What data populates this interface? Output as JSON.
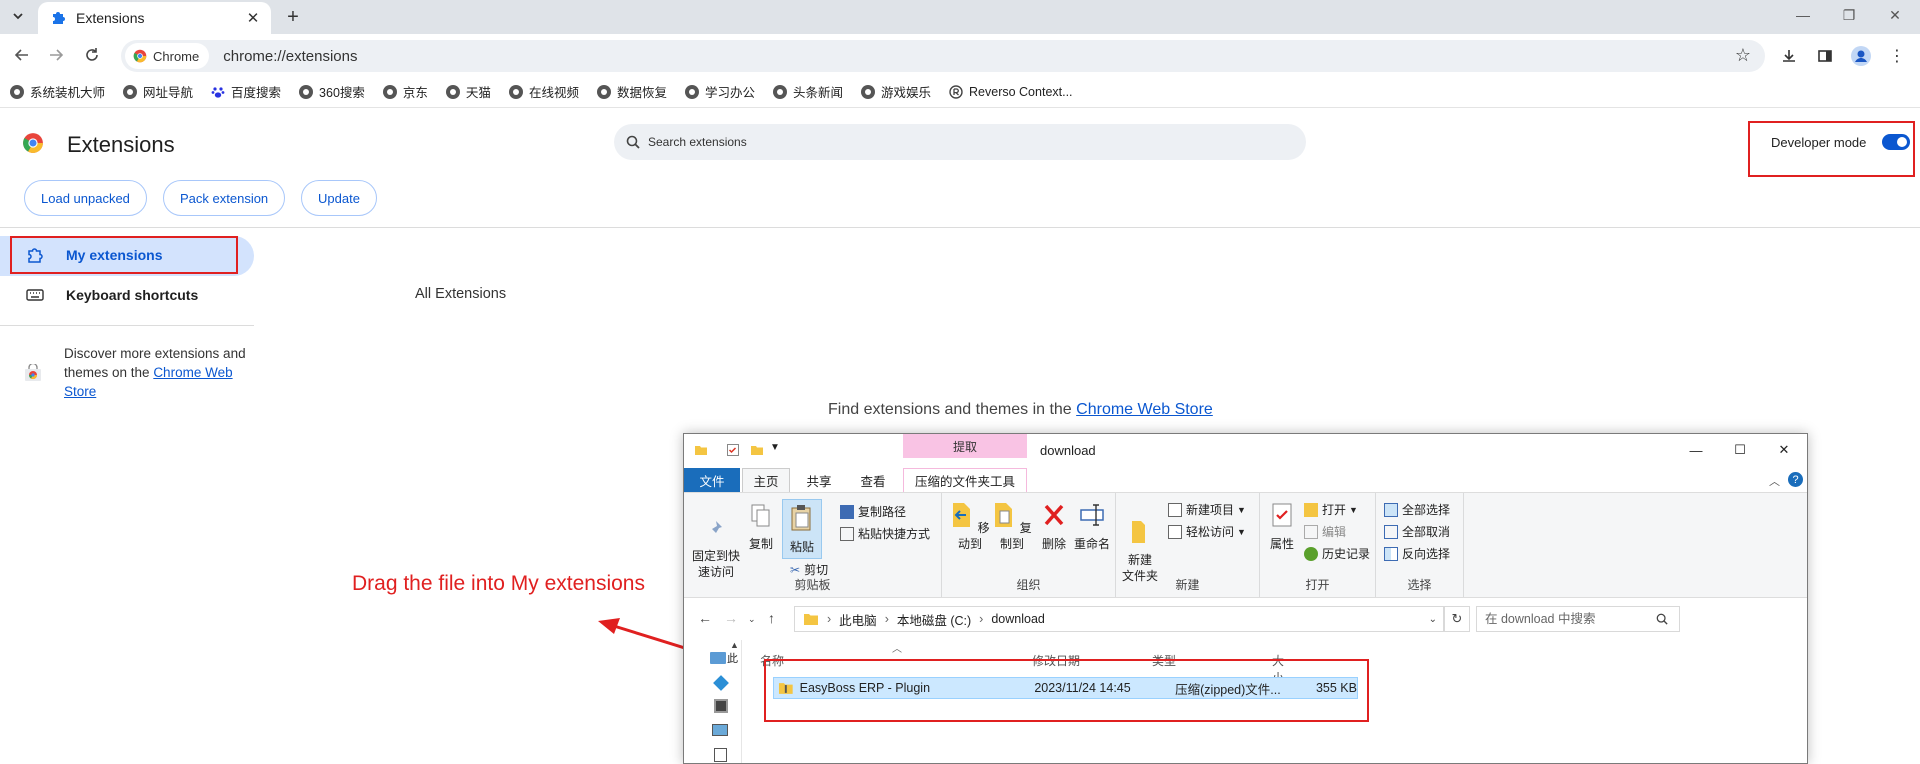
{
  "tab": {
    "title": "Extensions",
    "close": "✕",
    "new": "+"
  },
  "window_controls": {
    "minimize": "—",
    "restore": "❐",
    "close": "✕"
  },
  "omnibox": {
    "site_chip": "Chrome",
    "url": "chrome://extensions"
  },
  "bookmarks": [
    {
      "label": "系统装机大师",
      "icon": "globe-icon"
    },
    {
      "label": "网址导航",
      "icon": "globe-icon"
    },
    {
      "label": "百度搜索",
      "icon": "paw-icon"
    },
    {
      "label": "360搜索",
      "icon": "globe-icon"
    },
    {
      "label": "京东",
      "icon": "globe-icon"
    },
    {
      "label": "天猫",
      "icon": "globe-icon"
    },
    {
      "label": "在线视频",
      "icon": "globe-icon"
    },
    {
      "label": "数据恢复",
      "icon": "globe-icon"
    },
    {
      "label": "学习办公",
      "icon": "globe-icon"
    },
    {
      "label": "头条新闻",
      "icon": "globe-icon"
    },
    {
      "label": "游戏娱乐",
      "icon": "globe-icon"
    },
    {
      "label": "Reverso Context...",
      "icon": "reverso-icon"
    }
  ],
  "header": {
    "title": "Extensions",
    "search_placeholder": "Search extensions",
    "developer_mode_label": "Developer mode",
    "developer_mode_on": true,
    "buttons": {
      "load_unpacked": "Load unpacked",
      "pack_extension": "Pack extension",
      "update": "Update"
    }
  },
  "sidebar": {
    "my_extensions": "My extensions",
    "keyboard_shortcuts": "Keyboard shortcuts",
    "discover_prefix": "Discover more extensions and themes on the ",
    "discover_link": "Chrome Web Store"
  },
  "main": {
    "all_extensions": "All Extensions",
    "find_prefix": "Find extensions and themes in the ",
    "find_link": "Chrome Web Store"
  },
  "annotation": {
    "text": "Drag the file into My extensions"
  },
  "explorer": {
    "tools_tab": "提取",
    "title": "download",
    "ribbon_tabs": {
      "file": "文件",
      "home": "主页",
      "share": "共享",
      "view": "查看",
      "ctx": "压缩的文件夹工具"
    },
    "clipboard": {
      "pin": "固定到快\n速访问",
      "copy": "复制",
      "paste": "粘贴",
      "copy_path": "复制路径",
      "paste_shortcut": "粘贴快捷方式",
      "cut": "剪切",
      "label": "剪贴板"
    },
    "organize": {
      "move_to": "移动到",
      "copy_to": "复制到",
      "delete": "删除",
      "rename": "重命名",
      "label": "组织"
    },
    "new": {
      "new_folder": "新建\n文件夹",
      "new_item": "新建项目",
      "easy_access": "轻松访问",
      "label": "新建"
    },
    "open": {
      "properties": "属性",
      "open": "打开",
      "edit": "编辑",
      "history": "历史记录",
      "label": "打开"
    },
    "select": {
      "select_all": "全部选择",
      "select_none": "全部取消",
      "invert": "反向选择",
      "label": "选择"
    },
    "path": {
      "pc": "此电脑",
      "drive": "本地磁盘 (C:)",
      "folder": "download"
    },
    "search_placeholder": "在 download 中搜索",
    "columns": {
      "name": "名称",
      "date": "修改日期",
      "type": "类型",
      "size": "大小"
    },
    "file": {
      "name": "EasyBoss ERP - Plugin",
      "date": "2023/11/24 14:45",
      "type": "压缩(zipped)文件...",
      "size": "355 KB"
    },
    "leftpane_partial": "此"
  }
}
